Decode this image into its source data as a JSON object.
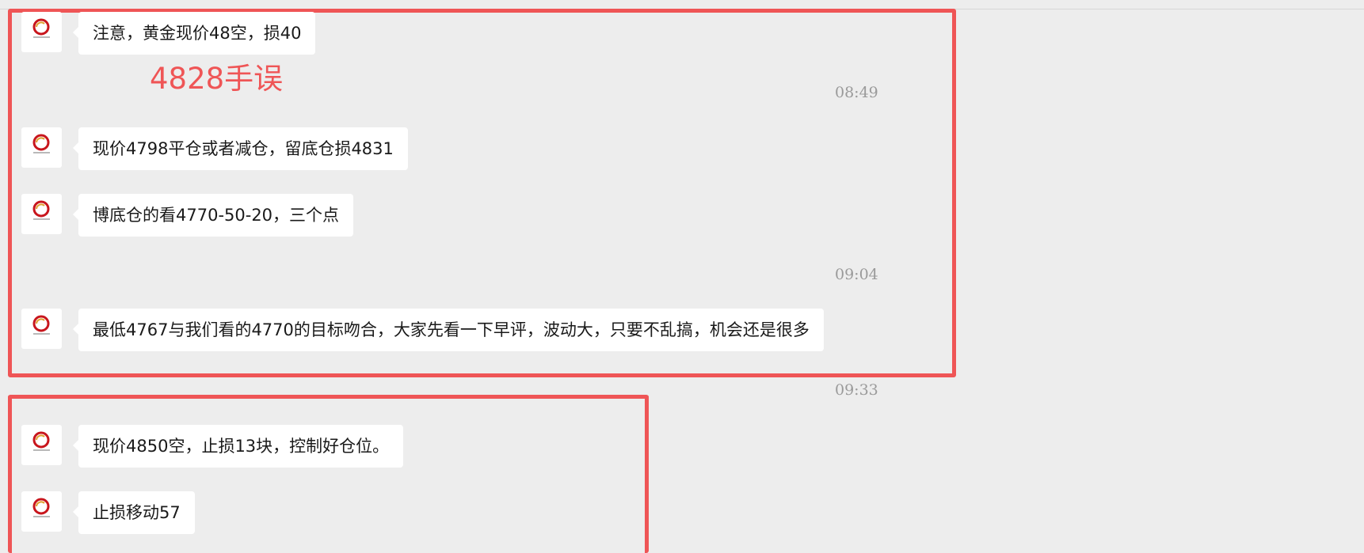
{
  "annotation": "4828手误",
  "messages": [
    {
      "text": "注意，黄金现价48空，损40"
    },
    {
      "text": "现价4798平仓或者减仓，留底仓损4831"
    },
    {
      "text": "博底仓的看4770-50-20，三个点"
    },
    {
      "text": "最低4767与我们看的4770的目标吻合，大家先看一下早评，波动大，只要不乱搞，机会还是很多"
    },
    {
      "text": "现价4850空，止损13块，控制好仓位。"
    },
    {
      "text": "止损移动57"
    }
  ],
  "timestamps": [
    "08:49",
    "09:04",
    "09:33"
  ],
  "avatar": {
    "icon": "brand-logo-icon",
    "brand_color": "#c8161d"
  },
  "colors": {
    "highlight": "#ef5556",
    "background": "#ededed",
    "bubble": "#ffffff"
  }
}
